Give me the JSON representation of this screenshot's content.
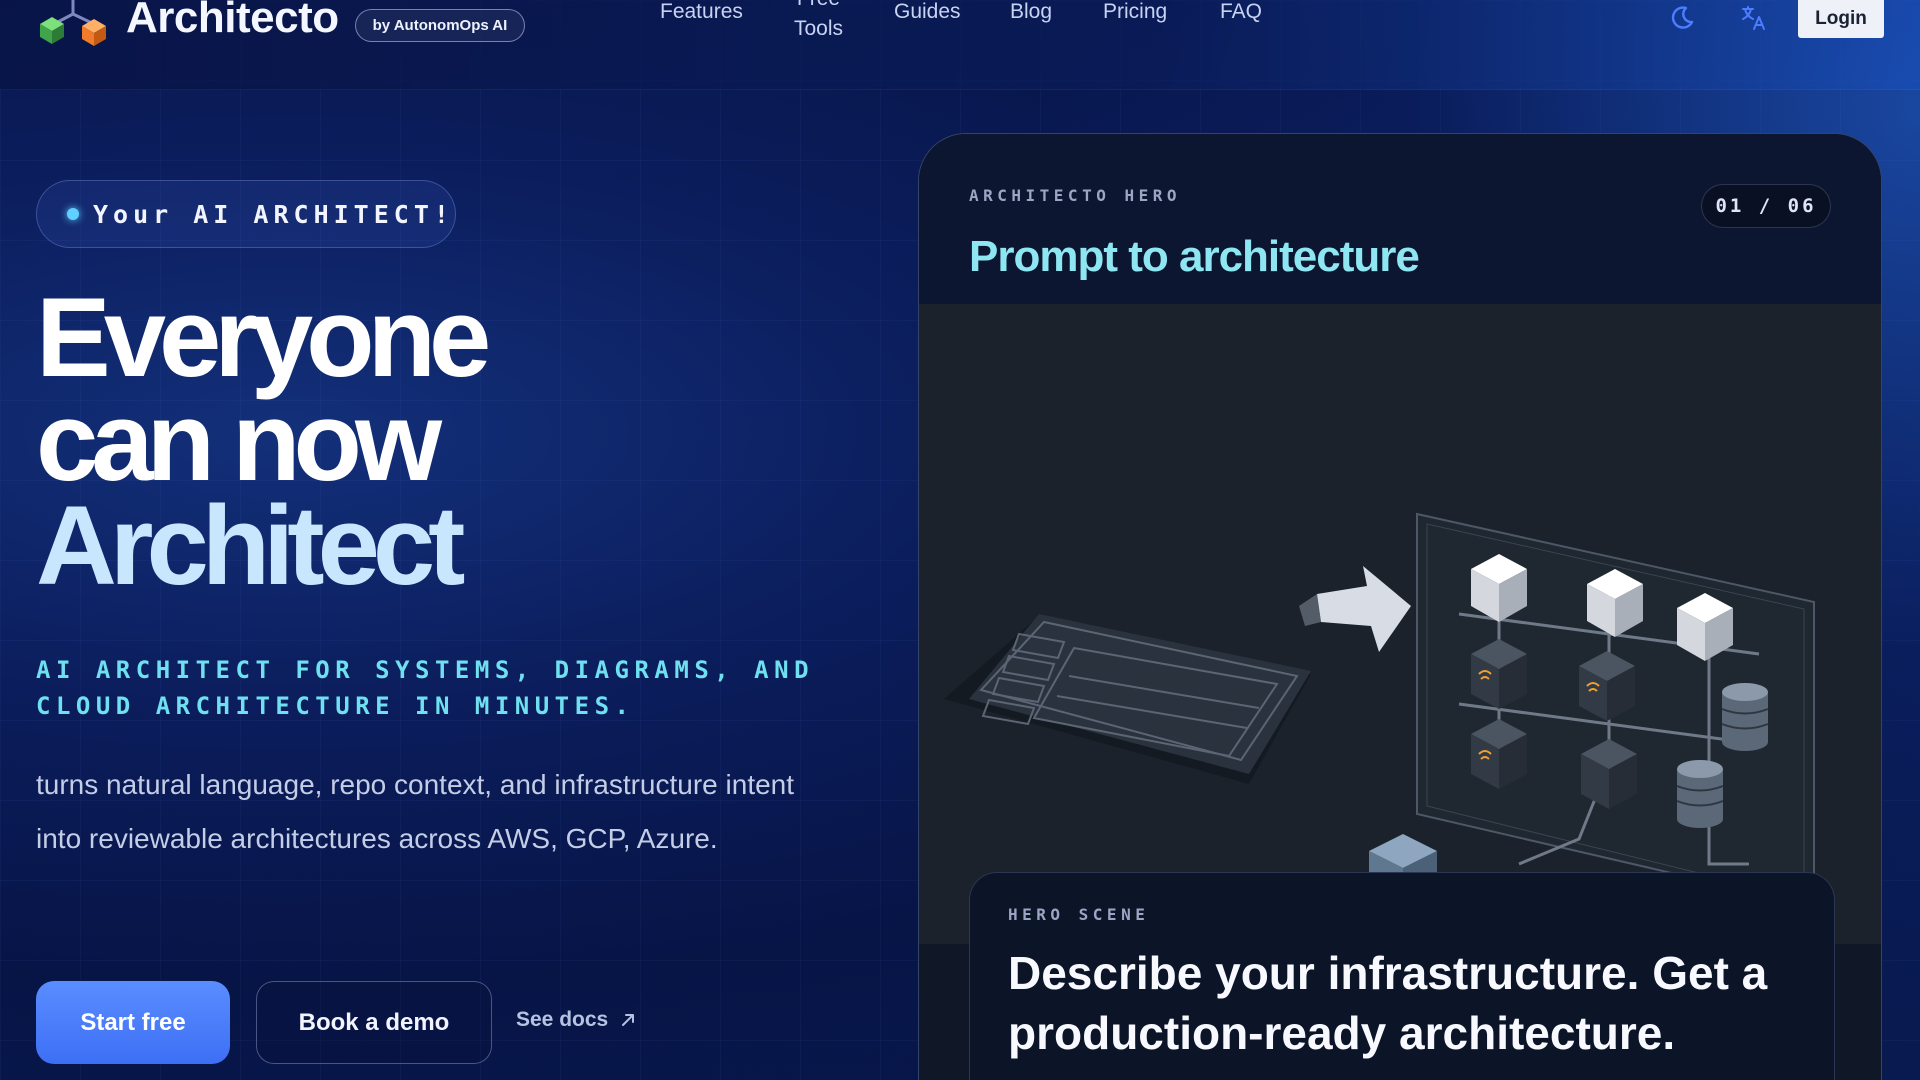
{
  "brand": {
    "name": "Architecto",
    "badge": "by AutonomOps AI"
  },
  "nav": {
    "features": "Features",
    "free_tools_line1": "Free",
    "free_tools_line2": "Tools",
    "guides": "Guides",
    "blog": "Blog",
    "pricing": "Pricing",
    "faq": "FAQ",
    "login": "Login",
    "theme_icon": "moon-icon",
    "language_icon": "translate-icon"
  },
  "hero": {
    "pill": "Your AI ARCHITECT!",
    "headline_line1": "Everyone",
    "headline_line2": "can now",
    "headline_accent": "Architect",
    "subhead": "AI ARCHITECT FOR SYSTEMS, DIAGRAMS, AND CLOUD ARCHITECTURE IN MINUTES.",
    "description": "turns natural language, repo context, and infrastructure intent into reviewable architectures across AWS, GCP, Azure.",
    "cta_primary": "Start free",
    "cta_secondary": "Book a demo",
    "cta_link": "See docs"
  },
  "card": {
    "eyebrow": "ARCHITECTO HERO",
    "counter": "01 / 06",
    "title": "Prompt to architecture",
    "scene_label": "HERO SCENE",
    "scene_text": "Describe your infrastructure. Get a production-ready architecture."
  },
  "colors": {
    "accent_blue": "#4a7dff",
    "cyan_text": "#6fe0f0",
    "card_title": "#8ee6f2",
    "background": "#0b1d5c"
  }
}
